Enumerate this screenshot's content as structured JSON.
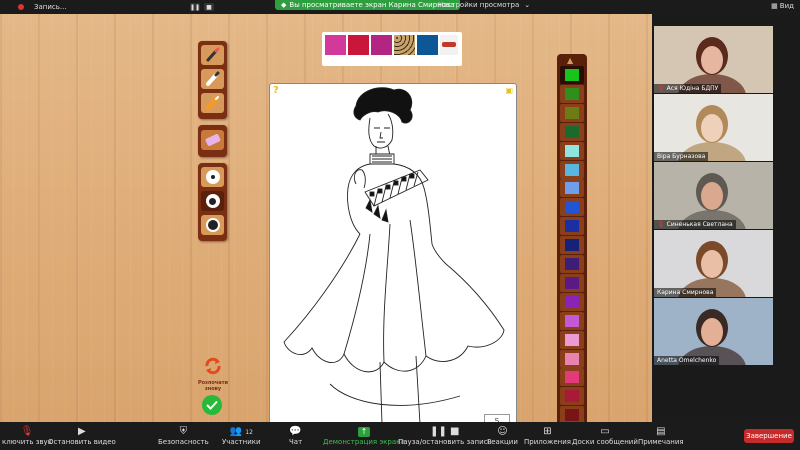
{
  "topbar": {
    "recording_label": "Запись...",
    "pause_icon": "pause-icon",
    "stop_icon": "stop-icon",
    "share_banner": "Вы просматриваете экран Карина Смирнова",
    "view_settings": "Настройки просмотра",
    "view_button": "Вид"
  },
  "game": {
    "left_tools": [
      "brush-icon",
      "marker-icon",
      "crayon-icon",
      "eraser-icon"
    ],
    "brush_sizes": [
      "small",
      "medium",
      "large"
    ],
    "top_swatches": [
      "#d2399a",
      "#c8173a",
      "#b32582",
      "leopard-pattern",
      "#0d5796",
      "#c0392b"
    ],
    "canvas_question_icon": "question-icon",
    "canvas_lock_icon": "lock-icon",
    "canvas_logo": "5",
    "palette_colors": [
      "#17c41a",
      "#2f8f1c",
      "#6e7c16",
      "#1a6a2e",
      "#8fe6df",
      "#58b6e0",
      "#6e9fe8",
      "#2254d6",
      "#1a2fa3",
      "#16227a",
      "#3c1d78",
      "#5a1a86",
      "#8a24b6",
      "#c35ad4",
      "#ee9ad2",
      "#ea82b0",
      "#e23b7a",
      "#a81a38",
      "#7a1515",
      "#6a3818"
    ],
    "restart_label": "Розпочати знову",
    "done_icon": "check-icon"
  },
  "participants": [
    {
      "name": "Ася Юдіна БДПУ",
      "muted": true,
      "bg": "#d5c6b4",
      "face": "#e7b6a0",
      "hair": "#5a2a1c"
    },
    {
      "name": "Віра Бурназова",
      "muted": false,
      "bg": "#e8e6e1",
      "face": "#efd0b8",
      "hair": "#b08a5a"
    },
    {
      "name": "Синенькая Светлана",
      "muted": true,
      "bg": "#b8b3a9",
      "face": "#d9a88e",
      "hair": "#5e5a52"
    },
    {
      "name": "Карина Смирнова",
      "muted": false,
      "bg": "#d9d9dc",
      "face": "#e9bfa6",
      "hair": "#7a4a2a"
    },
    {
      "name": "Anetta Omelchenko",
      "muted": false,
      "bg": "#9fb3c8",
      "face": "#e3b097",
      "hair": "#3a2a26"
    }
  ],
  "toolbar": {
    "mute": "ключить звук",
    "video": "Остановить видео",
    "security": "Безопасность",
    "participants": "Участники",
    "participants_count": "12",
    "chat": "Чат",
    "share": "Демонстрация экрана",
    "pause_recording": "Пауза/остановить запись",
    "reactions": "Реакции",
    "apps": "Приложения",
    "whiteboards": "Доски сообщений",
    "notes": "Примечания",
    "end": "Завершение"
  },
  "colors": {
    "share_green": "#2e9f3f",
    "end_red": "#c62b2b",
    "panel_brown": "#7a2e12"
  }
}
